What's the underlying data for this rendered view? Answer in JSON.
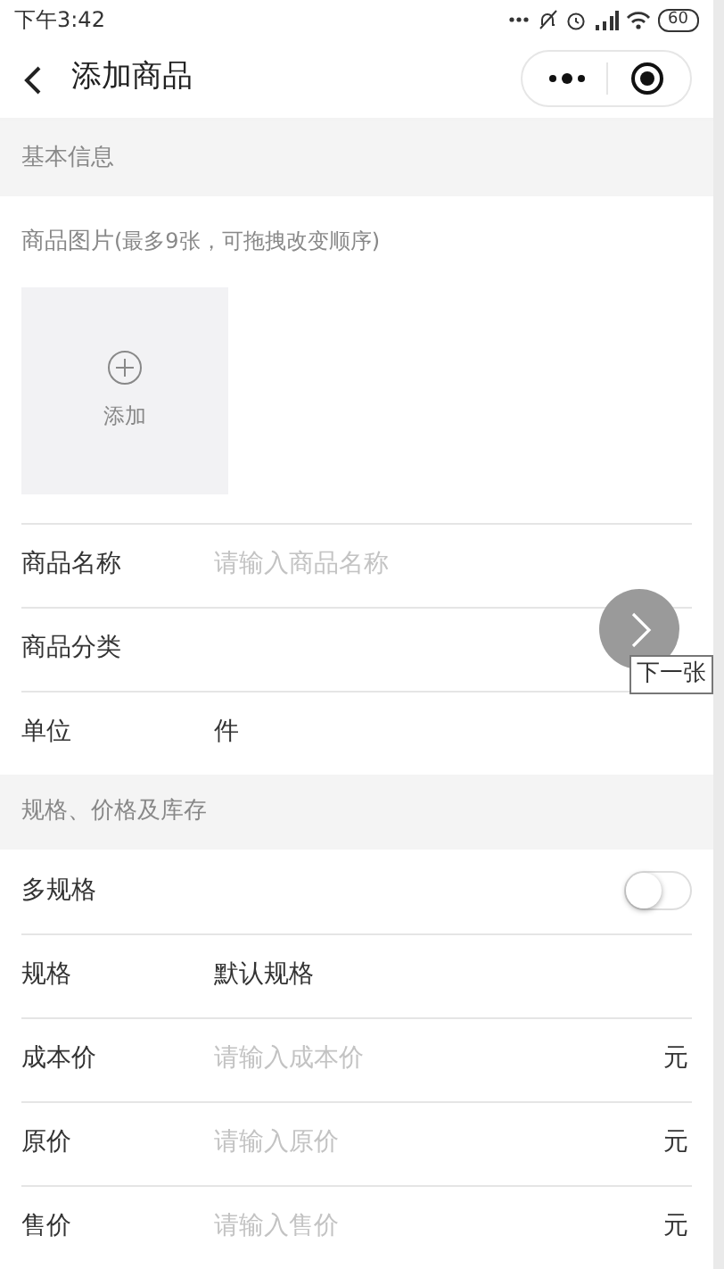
{
  "status_bar": {
    "time": "下午3:42",
    "battery": "60"
  },
  "nav": {
    "title": "添加商品"
  },
  "sections": [
    {
      "title": "基本信息",
      "photo": {
        "label": "商品图片",
        "hint": "(最多9张，可拖拽改变顺序)",
        "add_label": "添加"
      },
      "rows": [
        {
          "kind": "input",
          "label": "商品名称",
          "placeholder": "请输入商品名称"
        },
        {
          "kind": "select",
          "label": "商品分类"
        },
        {
          "kind": "text",
          "label": "单位",
          "value": "件"
        }
      ]
    },
    {
      "title": "规格、价格及库存",
      "rows": [
        {
          "kind": "switch",
          "label": "多规格",
          "on": false
        },
        {
          "kind": "text",
          "label": "规格",
          "value": "默认规格"
        },
        {
          "kind": "input",
          "label": "成本价",
          "placeholder": "请输入成本价",
          "unit": "元"
        },
        {
          "kind": "input",
          "label": "原价",
          "placeholder": "请输入原价",
          "unit": "元"
        },
        {
          "kind": "input",
          "label": "售价",
          "placeholder": "请输入售价",
          "unit": "元"
        }
      ]
    }
  ],
  "overlay": {
    "tooltip": "下一张"
  }
}
